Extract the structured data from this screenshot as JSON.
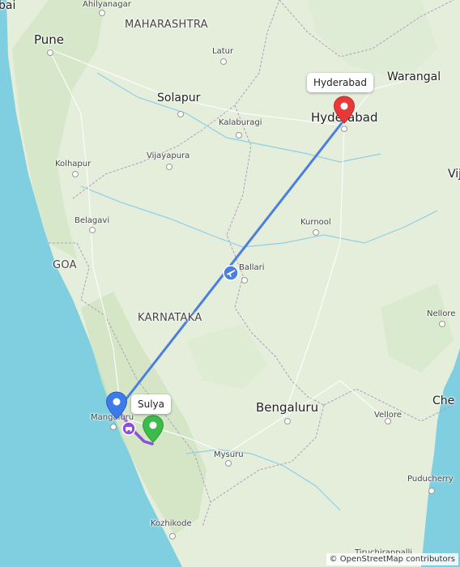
{
  "map": {
    "labels": {
      "pune": "Pune",
      "maharashtra": "MAHARASHTRA",
      "ahilyanagar": "Ahilyanagar",
      "latur": "Latur",
      "solapur": "Solapur",
      "kalaburagi": "Kalaburagi",
      "vijayapura": "Vijayapura",
      "kolhapur": "Kolhapur",
      "belagavi": "Belagavi",
      "goa": "GOA",
      "karnataka": "KARNATAKA",
      "ballari": "Ballari",
      "kurnool": "Kurnool",
      "hyderabad_city": "Hyderabad",
      "warangal": "Warangal",
      "nellore": "Nellore",
      "bengaluru": "Bengaluru",
      "vellore": "Vellore",
      "mysuru": "Mysuru",
      "kozhikode": "Kozhikode",
      "puducherry": "Puducherry",
      "mangaluru": "Mangaluru",
      "tiruchirappalli": "Tiruchirappalli",
      "edge_left": "bai",
      "edge_right_vij": "Vij",
      "edge_right_che": "Che"
    },
    "markers": {
      "origin_label": "Sulya",
      "destination_label": "Hyderabad"
    },
    "attribution": "© OpenStreetMap contributors",
    "colors": {
      "land": "#e4eedb",
      "sea": "#7fcfe0",
      "flight_route": "#4a7fe0",
      "drive_route": "#8a4fe0",
      "origin_marker": "#3c7be8",
      "destination_marker": "#e8393a",
      "green_marker": "#3cba4a"
    },
    "icons": [
      "airplane-icon",
      "car-icon",
      "map-pin-icon"
    ]
  }
}
